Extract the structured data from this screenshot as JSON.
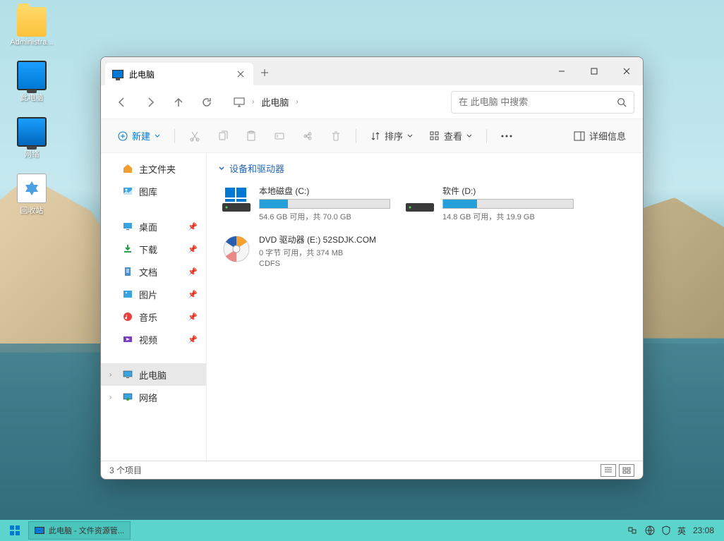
{
  "desktop": {
    "icons": [
      {
        "name": "administrator-folder",
        "label": "Administra..."
      },
      {
        "name": "this-pc",
        "label": "此电脑"
      },
      {
        "name": "network",
        "label": "网络"
      },
      {
        "name": "recycle-bin",
        "label": "回收站"
      }
    ]
  },
  "window": {
    "tab_title": "此电脑",
    "breadcrumb": "此电脑",
    "search_placeholder": "在 此电脑 中搜索",
    "toolbar": {
      "new": "新建",
      "sort": "排序",
      "view": "查看",
      "details": "详细信息"
    },
    "sidebar": {
      "home": "主文件夹",
      "gallery": "图库",
      "desktop": "桌面",
      "downloads": "下载",
      "documents": "文档",
      "pictures": "图片",
      "music": "音乐",
      "videos": "视频",
      "this_pc": "此电脑",
      "network": "网络"
    },
    "content": {
      "section_title": "设备和驱动器",
      "drives": [
        {
          "name": "本地磁盘 (C:)",
          "stat": "54.6 GB 可用，共 70.0 GB",
          "fill": 22,
          "type": "hdd"
        },
        {
          "name": "软件 (D:)",
          "stat": "14.8 GB 可用，共 19.9 GB",
          "fill": 26,
          "type": "hdd"
        },
        {
          "name": "DVD 驱动器 (E:) 52SDJK.COM",
          "stat": "0 字节 可用，共 374 MB",
          "sub": "CDFS",
          "type": "dvd"
        }
      ]
    },
    "status": "3 个项目"
  },
  "taskbar": {
    "task_label": "此电脑 - 文件资源管...",
    "ime": "英",
    "time": "23:08"
  }
}
